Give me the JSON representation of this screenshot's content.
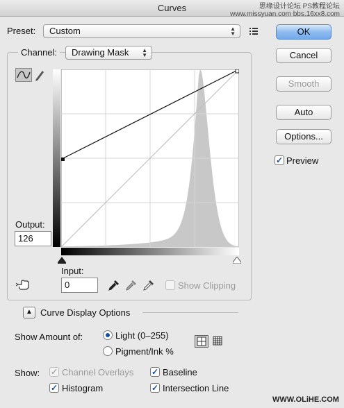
{
  "window": {
    "title": "Curves"
  },
  "watermark": {
    "top_line1": "思缘设计论坛  PS教程论坛",
    "top_line2": "www.missyuan.com  bbs.16xx8.com",
    "bottom": "WWW.OLiHE.COM"
  },
  "preset": {
    "label": "Preset:",
    "value": "Custom"
  },
  "channel": {
    "label": "Channel:",
    "value": "Drawing Mask"
  },
  "output": {
    "label": "Output:",
    "value": "126"
  },
  "input": {
    "label": "Input:",
    "value": "0"
  },
  "show_clipping": {
    "label": "Show Clipping",
    "checked": false
  },
  "curve_display_options": {
    "label": "Curve Display Options"
  },
  "show_amount": {
    "label": "Show Amount of:",
    "options": [
      {
        "label": "Light  (0–255)",
        "selected": true
      },
      {
        "label": "Pigment/Ink %",
        "selected": false
      }
    ]
  },
  "show": {
    "label": "Show:",
    "channel_overlays": {
      "label": "Channel Overlays",
      "checked": true
    },
    "baseline": {
      "label": "Baseline",
      "checked": true
    },
    "histogram": {
      "label": "Histogram",
      "checked": true
    },
    "intersection_line": {
      "label": "Intersection Line",
      "checked": true
    }
  },
  "buttons": {
    "ok": "OK",
    "cancel": "Cancel",
    "smooth": "Smooth",
    "auto": "Auto",
    "options": "Options..."
  },
  "preview": {
    "label": "Preview",
    "checked": true
  },
  "curve": {
    "points": [
      [
        0,
        126
      ],
      [
        255,
        255
      ]
    ],
    "histogram_peak": 200
  }
}
